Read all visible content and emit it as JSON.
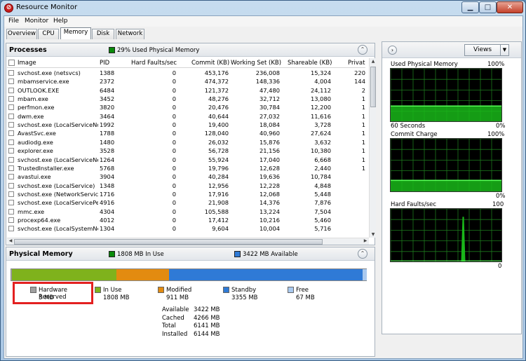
{
  "window": {
    "title": "Resource Monitor"
  },
  "menu": [
    "File",
    "Monitor",
    "Help"
  ],
  "tabs": [
    "Overview",
    "CPU",
    "Memory",
    "Disk",
    "Network"
  ],
  "active_tab": "Memory",
  "processes": {
    "title": "Processes",
    "status": "29% Used Physical Memory",
    "status_color": "#0a8a0a",
    "columns": [
      "Image",
      "PID",
      "Hard Faults/sec",
      "Commit (KB)",
      "Working Set (KB)",
      "Shareable (KB)",
      "Privat"
    ],
    "rows": [
      [
        "svchost.exe (netsvcs)",
        "1388",
        "0",
        "453,176",
        "236,008",
        "15,324",
        "220"
      ],
      [
        "mbamservice.exe",
        "2372",
        "0",
        "474,372",
        "148,336",
        "4,004",
        "144"
      ],
      [
        "OUTLOOK.EXE",
        "6484",
        "0",
        "121,372",
        "47,480",
        "24,112",
        "2"
      ],
      [
        "mbam.exe",
        "3452",
        "0",
        "48,276",
        "32,712",
        "13,080",
        "1"
      ],
      [
        "perfmon.exe",
        "3820",
        "0",
        "20,476",
        "30,784",
        "12,200",
        "1"
      ],
      [
        "dwm.exe",
        "3464",
        "0",
        "40,644",
        "27,032",
        "11,616",
        "1"
      ],
      [
        "svchost.exe (LocalServiceNo...",
        "1992",
        "0",
        "19,400",
        "18,084",
        "3,728",
        "1"
      ],
      [
        "AvastSvc.exe",
        "1788",
        "0",
        "128,040",
        "40,960",
        "27,624",
        "1"
      ],
      [
        "audiodg.exe",
        "1480",
        "0",
        "26,032",
        "15,876",
        "3,632",
        "1"
      ],
      [
        "explorer.exe",
        "3528",
        "0",
        "56,728",
        "21,156",
        "10,380",
        "1"
      ],
      [
        "svchost.exe (LocalServiceNet...",
        "1264",
        "0",
        "55,924",
        "17,040",
        "6,668",
        "1"
      ],
      [
        "TrustedInstaller.exe",
        "5768",
        "0",
        "19,796",
        "12,628",
        "2,440",
        "1"
      ],
      [
        "avastui.exe",
        "3904",
        "0",
        "40,284",
        "19,636",
        "10,784",
        ""
      ],
      [
        "svchost.exe (LocalService)",
        "1348",
        "0",
        "12,956",
        "12,228",
        "4,848",
        ""
      ],
      [
        "svchost.exe (NetworkService)",
        "1716",
        "0",
        "17,916",
        "12,068",
        "5,448",
        ""
      ],
      [
        "svchost.exe (LocalServicePee...",
        "4916",
        "0",
        "21,908",
        "14,376",
        "7,876",
        ""
      ],
      [
        "mmc.exe",
        "4304",
        "0",
        "105,588",
        "13,224",
        "7,504",
        ""
      ],
      [
        "procexp64.exe",
        "4012",
        "0",
        "17,412",
        "10,216",
        "5,460",
        ""
      ],
      [
        "svchost.exe (LocalSystemNet...",
        "1304",
        "0",
        "9,604",
        "10,004",
        "5,716",
        ""
      ]
    ]
  },
  "physical_memory": {
    "title": "Physical Memory",
    "in_use_status": "1808 MB In Use",
    "available_status": "3422 MB Available",
    "bar": [
      {
        "name": "Hardware Reserved",
        "mb": 3,
        "color": "#a0a0a0"
      },
      {
        "name": "In Use",
        "mb": 1808,
        "color": "#7fb21c"
      },
      {
        "name": "Modified",
        "mb": 911,
        "color": "#e38b10"
      },
      {
        "name": "Standby",
        "mb": 3355,
        "color": "#2f7ad6"
      },
      {
        "name": "Free",
        "mb": 67,
        "color": "#a9c9ef"
      }
    ],
    "legend": [
      {
        "label": "Hardware Reserved",
        "value": "3 MB",
        "color": "#a0a0a0"
      },
      {
        "label": "In Use",
        "value": "1808 MB",
        "color": "#7fb21c"
      },
      {
        "label": "Modified",
        "value": "911 MB",
        "color": "#e38b10"
      },
      {
        "label": "Standby",
        "value": "3355 MB",
        "color": "#2f7ad6"
      },
      {
        "label": "Free",
        "value": "67 MB",
        "color": "#a9c9ef"
      }
    ],
    "stats": [
      {
        "label": "Available",
        "value": "3422 MB"
      },
      {
        "label": "Cached",
        "value": "4266 MB"
      },
      {
        "label": "Total",
        "value": "6141 MB"
      },
      {
        "label": "Installed",
        "value": "6144 MB"
      }
    ]
  },
  "right_panel": {
    "views_label": "Views",
    "graphs": [
      {
        "title": "Used Physical Memory",
        "max": "100%",
        "min": "0%",
        "footer": "60 Seconds",
        "level": 29
      },
      {
        "title": "Commit Charge",
        "max": "100%",
        "min": "0%",
        "level": 21
      },
      {
        "title": "Hard Faults/sec",
        "max": "100",
        "min": "0",
        "spike": 85
      }
    ]
  }
}
